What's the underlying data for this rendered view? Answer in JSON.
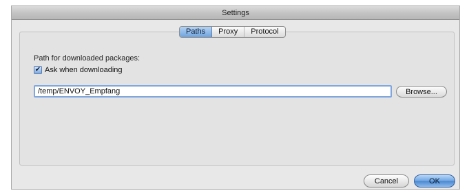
{
  "window": {
    "title": "Settings"
  },
  "tabs": [
    {
      "label": "Paths",
      "selected": true
    },
    {
      "label": "Proxy",
      "selected": false
    },
    {
      "label": "Protocol",
      "selected": false
    }
  ],
  "paths_pane": {
    "path_label": "Path for downloaded packages:",
    "ask_checkbox": {
      "label": "Ask when downloading",
      "checked": true,
      "glyph": "✔"
    },
    "path_input": {
      "value": "/temp/ENVOY_Empfang"
    },
    "browse_label": "Browse..."
  },
  "footer": {
    "cancel_label": "Cancel",
    "ok_label": "OK"
  },
  "colors": {
    "accent": "#6fa6e2",
    "window_bg": "#e8e8e8"
  }
}
